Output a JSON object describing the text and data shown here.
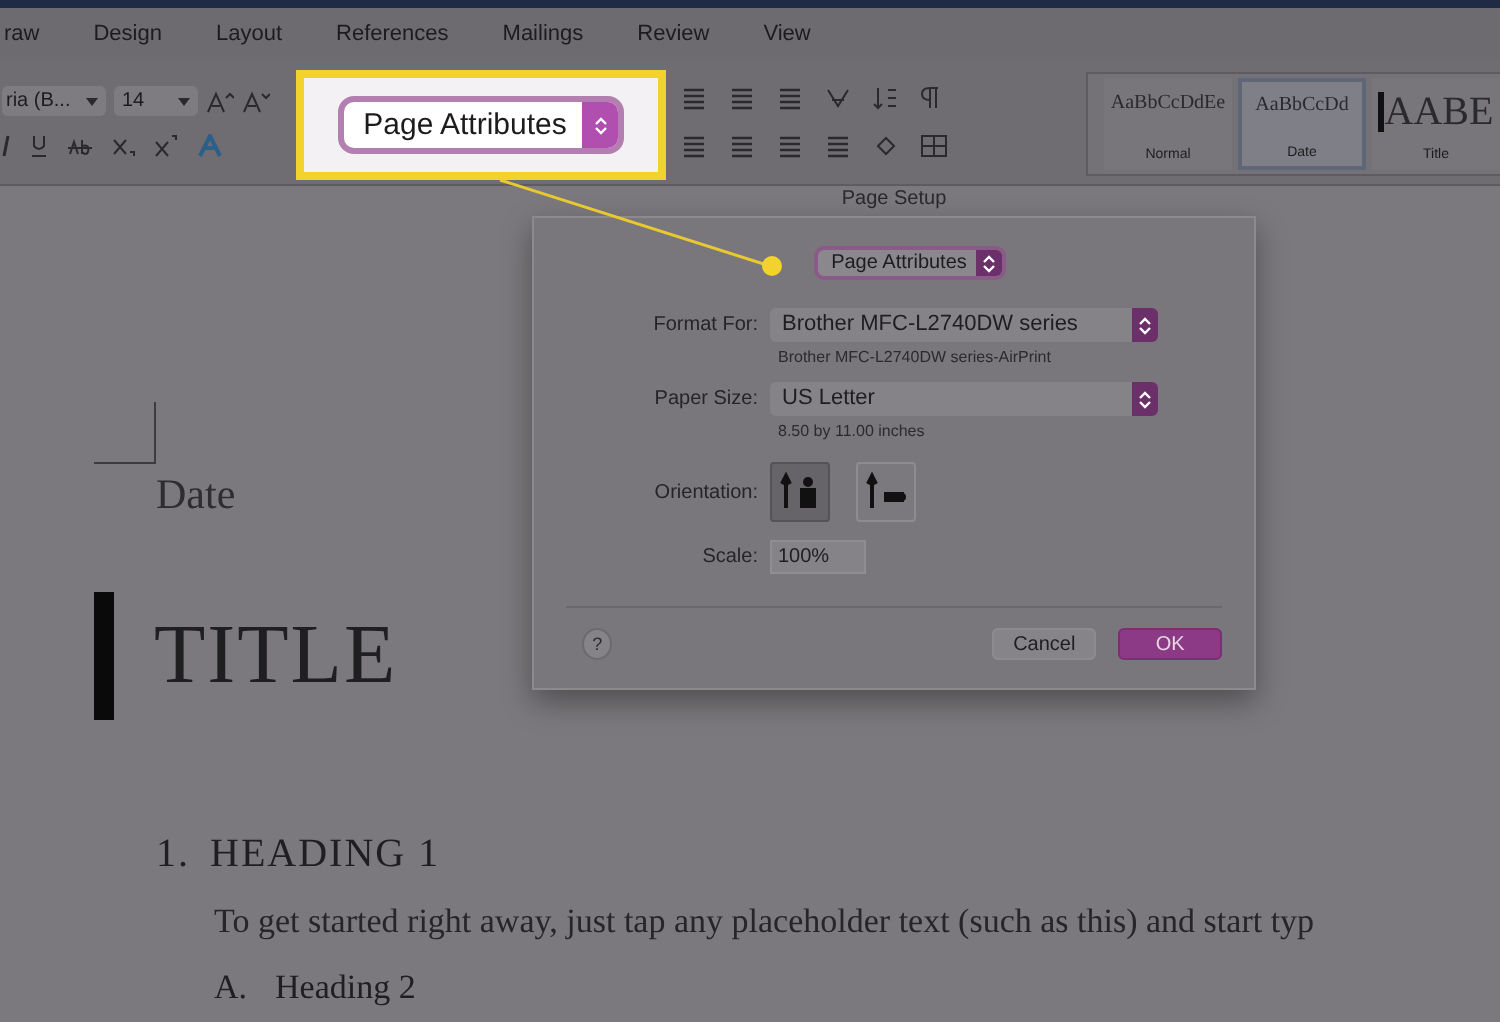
{
  "menu_tabs": [
    "raw",
    "Design",
    "Layout",
    "References",
    "Mailings",
    "Review",
    "View"
  ],
  "ribbon": {
    "font_name": "ria (B...",
    "font_size": "14",
    "styles": [
      {
        "sample": "AaBbCcDdEe",
        "name": "Normal",
        "selected": false
      },
      {
        "sample": "AaBbCcDd",
        "name": "Date",
        "selected": true
      },
      {
        "sample": "AABE",
        "name": "Title",
        "selected": false
      }
    ]
  },
  "callout": {
    "label": "Page Attributes"
  },
  "dialog": {
    "title": "Page Setup",
    "settings_menu": "Page Attributes",
    "format_for": {
      "label": "Format For:",
      "value": "Brother MFC-L2740DW series",
      "note": "Brother MFC-L2740DW series-AirPrint"
    },
    "paper_size": {
      "label": "Paper Size:",
      "value": "US Letter",
      "note": "8.50 by 11.00 inches"
    },
    "orientation": {
      "label": "Orientation:",
      "options": [
        {
          "kind": "portrait",
          "selected": true
        },
        {
          "kind": "landscape",
          "selected": false
        }
      ]
    },
    "scale": {
      "label": "Scale:",
      "value": "100%"
    },
    "help": "?",
    "cancel": "Cancel",
    "ok": "OK"
  },
  "document": {
    "date": "Date",
    "title": "TITLE",
    "heading1": {
      "number": "1.",
      "text": "HEADING 1"
    },
    "paragraph": "To get started right away, just tap any placeholder text (such as this) and start typ",
    "heading2": {
      "number": "A.",
      "text": "Heading 2"
    }
  }
}
